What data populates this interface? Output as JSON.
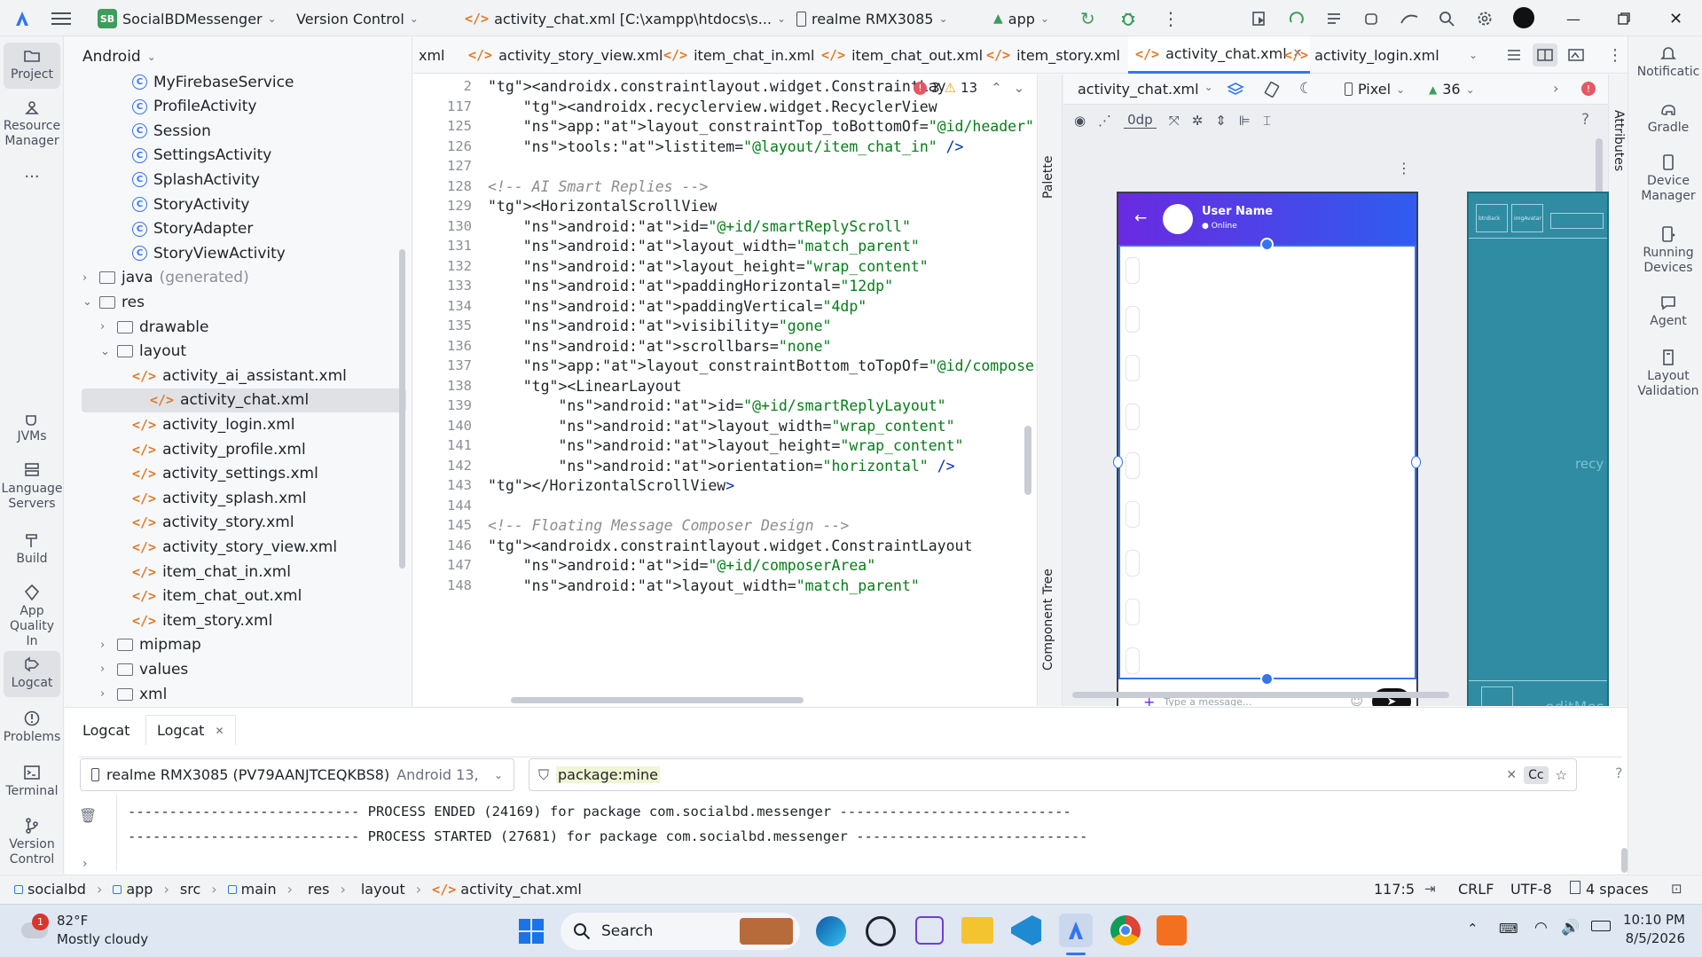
{
  "titlebar": {
    "project_badge": "SB",
    "project_name": "SocialBDMessenger",
    "vcs": "Version Control",
    "current_file": "activity_chat.xml [C:\\xampp\\htdocs\\s...",
    "device": "realme RMX3085",
    "run_config": "app"
  },
  "left_strip": {
    "project": "Project",
    "resource_manager": "Resource Manager",
    "more": "...",
    "jvms": "JVMs",
    "language_servers": "Language Servers",
    "build": "Build",
    "app_quality": "App Quality In",
    "logcat": "Logcat",
    "problems": "Problems",
    "terminal": "Terminal",
    "version_control": "Version Control"
  },
  "right_strip": {
    "notifications": "Notificatic",
    "gradle": "Gradle",
    "device_manager": "Device Manager",
    "running_devices": "Running Devices",
    "agent": "Agent",
    "layout_validation": "Layout Validation"
  },
  "project_panel": {
    "view": "Android",
    "items": [
      {
        "label": "MyFirebaseService",
        "type": "class"
      },
      {
        "label": "ProfileActivity",
        "type": "class"
      },
      {
        "label": "Session",
        "type": "class"
      },
      {
        "label": "SettingsActivity",
        "type": "class"
      },
      {
        "label": "SplashActivity",
        "type": "class"
      },
      {
        "label": "StoryActivity",
        "type": "class"
      },
      {
        "label": "StoryAdapter",
        "type": "class"
      },
      {
        "label": "StoryViewActivity",
        "type": "class"
      },
      {
        "label": "java",
        "suffix": "(generated)",
        "type": "folder"
      },
      {
        "label": "res",
        "type": "folder"
      },
      {
        "label": "drawable",
        "type": "folder"
      },
      {
        "label": "layout",
        "type": "folder"
      },
      {
        "label": "activity_ai_assistant.xml",
        "type": "xml"
      },
      {
        "label": "activity_chat.xml",
        "type": "xml"
      },
      {
        "label": "activity_login.xml",
        "type": "xml"
      },
      {
        "label": "activity_profile.xml",
        "type": "xml"
      },
      {
        "label": "activity_settings.xml",
        "type": "xml"
      },
      {
        "label": "activity_splash.xml",
        "type": "xml"
      },
      {
        "label": "activity_story.xml",
        "type": "xml"
      },
      {
        "label": "activity_story_view.xml",
        "type": "xml"
      },
      {
        "label": "item_chat_in.xml",
        "type": "xml"
      },
      {
        "label": "item_chat_out.xml",
        "type": "xml"
      },
      {
        "label": "item_story.xml",
        "type": "xml"
      },
      {
        "label": "mipmap",
        "type": "folder"
      },
      {
        "label": "values",
        "type": "folder"
      },
      {
        "label": "xml",
        "type": "folder"
      }
    ]
  },
  "tabs": [
    "xml",
    "activity_story_view.xml",
    "item_chat_in.xml",
    "item_chat_out.xml",
    "item_story.xml",
    "activity_chat.xml",
    "activity_login.xml"
  ],
  "editor": {
    "errors": "3",
    "warnings": "13",
    "lines": [
      {
        "n": "2",
        "t": "<androidx.constraintlayout.widget.ConstraintLay"
      },
      {
        "n": "117",
        "t": "    <androidx.recyclerview.widget.RecyclerView"
      },
      {
        "n": "125",
        "t": "    app:layout_constraintTop_toBottomOf=\"@id/header\""
      },
      {
        "n": "126",
        "t": "    tools:listitem=\"@layout/item_chat_in\" />"
      },
      {
        "n": "127",
        "t": ""
      },
      {
        "n": "128",
        "t": "<!-- AI Smart Replies -->"
      },
      {
        "n": "129",
        "t": "<HorizontalScrollView"
      },
      {
        "n": "130",
        "t": "    android:id=\"@+id/smartReplyScroll\""
      },
      {
        "n": "131",
        "t": "    android:layout_width=\"match_parent\""
      },
      {
        "n": "132",
        "t": "    android:layout_height=\"wrap_content\""
      },
      {
        "n": "133",
        "t": "    android:paddingHorizontal=\"12dp\""
      },
      {
        "n": "134",
        "t": "    android:paddingVertical=\"4dp\""
      },
      {
        "n": "135",
        "t": "    android:visibility=\"gone\""
      },
      {
        "n": "136",
        "t": "    android:scrollbars=\"none\""
      },
      {
        "n": "137",
        "t": "    app:layout_constraintBottom_toTopOf=\"@id/composerArea\">"
      },
      {
        "n": "138",
        "t": "    <LinearLayout"
      },
      {
        "n": "139",
        "t": "        android:id=\"@+id/smartReplyLayout\""
      },
      {
        "n": "140",
        "t": "        android:layout_width=\"wrap_content\""
      },
      {
        "n": "141",
        "t": "        android:layout_height=\"wrap_content\""
      },
      {
        "n": "142",
        "t": "        android:orientation=\"horizontal\" />"
      },
      {
        "n": "143",
        "t": "</HorizontalScrollView>"
      },
      {
        "n": "144",
        "t": ""
      },
      {
        "n": "145",
        "t": "<!-- Floating Message Composer Design -->"
      },
      {
        "n": "146",
        "t": "<androidx.constraintlayout.widget.ConstraintLayout"
      },
      {
        "n": "147",
        "t": "    android:id=\"@+id/composerArea\""
      },
      {
        "n": "148",
        "t": "    android:layout_width=\"match_parent\""
      }
    ]
  },
  "design": {
    "palette": "Palette",
    "component_tree": "Component Tree",
    "attributes": "Attributes",
    "file": "activity_chat.xml",
    "device": "Pixel",
    "api": "36",
    "margin": "0dp",
    "preview_user": "User Name",
    "preview_status": "Online",
    "composer_placeholder": "Type a message...",
    "blueprint_label": "recy",
    "blueprint_bottom": "editMes",
    "blueprint_btn1": "btnBack",
    "blueprint_btn2": "imgAvatar"
  },
  "logcat": {
    "tab1": "Logcat",
    "tab2": "Logcat",
    "device": "realme RMX3085 (PV79AANJTCEQKBS8)",
    "android": "Android 13,",
    "filter": "package:mine",
    "cc": "Cc",
    "lines": [
      "---------------------------- PROCESS ENDED (24169) for package com.socialbd.messenger ----------------------------",
      "---------------------------- PROCESS STARTED (27681) for package com.socialbd.messenger ----------------------------"
    ]
  },
  "status": {
    "crumbs": [
      "socialbd",
      "app",
      "src",
      "main",
      "res",
      "layout",
      "activity_chat.xml"
    ],
    "position": "117:5",
    "line_sep": "CRLF",
    "encoding": "UTF-8",
    "indent": "4 spaces"
  },
  "taskbar": {
    "weather_badge": "1",
    "temp": "82°F",
    "weather": "Mostly cloudy",
    "search": "Search",
    "time": "10:10 PM",
    "date": "8/5/2026"
  }
}
